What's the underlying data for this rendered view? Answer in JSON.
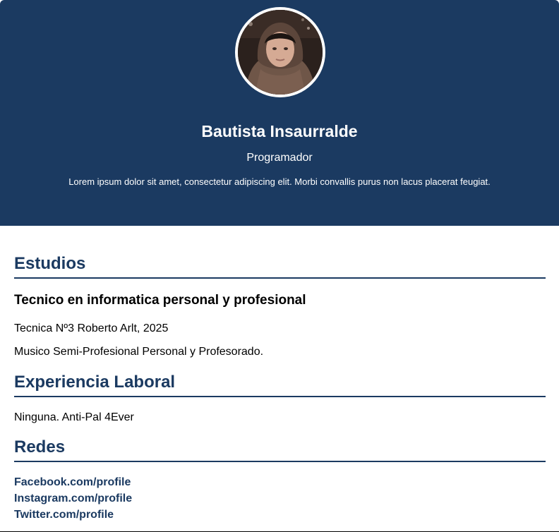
{
  "colors": {
    "header_bg": "#1b3a61",
    "accent": "#1b3a61",
    "text": "#000000",
    "header_text": "#ffffff"
  },
  "profile": {
    "name": "Bautista Insaurralde",
    "role": "Programador",
    "bio": "Lorem ipsum dolor sit amet, consectetur adipiscing elit. Morbi convallis purus non lacus placerat feugiat."
  },
  "education": {
    "title": "Estudios",
    "degree": "Tecnico en informatica personal y profesional",
    "school": "Tecnica Nº3 Roberto Arlt, 2025",
    "extra": "Musico Semi-Profesional Personal y Profesorado."
  },
  "experience": {
    "title": "Experiencia Laboral",
    "text": "Ninguna. Anti-Pal 4Ever"
  },
  "social": {
    "title": "Redes",
    "links": [
      {
        "label": "Facebook.com/profile"
      },
      {
        "label": "Instagram.com/profile"
      },
      {
        "label": "Twitter.com/profile"
      }
    ]
  }
}
